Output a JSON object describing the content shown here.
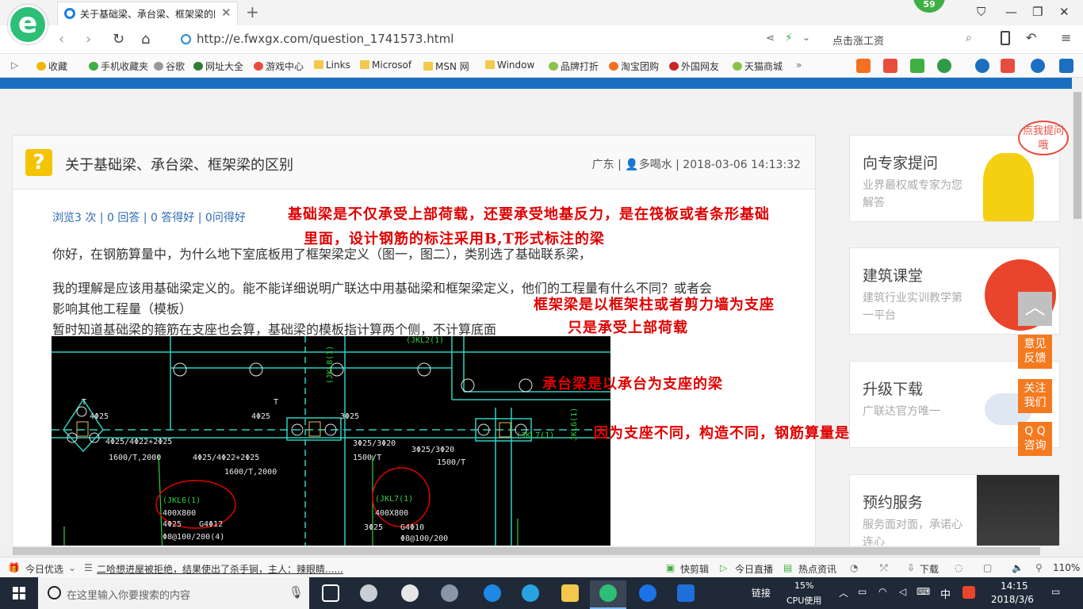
{
  "browser": {
    "logo_letter": "e",
    "tab_title": "关于基础梁、承台梁、框架梁的区",
    "tab_close": "✕",
    "new_tab": "+",
    "notification_count": "59",
    "url": "http://e.fwxgx.com/question_1741573.html",
    "search_hint": "点击涨工资"
  },
  "favorites": [
    {
      "label": "收藏",
      "icon": "star-icon"
    },
    {
      "label": "手机收藏夹",
      "icon": "phone-icon"
    },
    {
      "label": "谷歌",
      "icon": "page-icon"
    },
    {
      "label": "网址大全",
      "icon": "globe-icon"
    },
    {
      "label": "游戏中心",
      "icon": "game-icon"
    },
    {
      "label": "Links",
      "icon": "folder-icon"
    },
    {
      "label": "Microsof",
      "icon": "folder-icon"
    },
    {
      "label": "MSN 网",
      "icon": "folder-icon"
    },
    {
      "label": "Window",
      "icon": "folder-icon"
    },
    {
      "label": "品牌打折",
      "icon": "leaf-icon"
    },
    {
      "label": "淘宝团购",
      "icon": "tao-icon"
    },
    {
      "label": "外国网友",
      "icon": "flag-icon"
    },
    {
      "label": "天猫商城",
      "icon": "leaf-icon"
    }
  ],
  "question": {
    "icon_char": "?",
    "title": "关于基础梁、承台梁、框架梁的区别",
    "meta": "广东 | 👤多喝水 | 2018-03-06 14:13:32",
    "stats": "浏览3 次 | 0 回答 | 0 答得好 | 0问得好",
    "line1": "你好，在钢筋算量中，为什么地下室底板用了框架梁定义（图一，图二），类别选了基础联系梁，",
    "line2": "我的理解是应该用基础梁定义的。能不能详细说明广联达中用基础梁和框架梁定义，他们的工程量有什么不同？或者会",
    "line3": "影响其他工程量（模板）",
    "line4": "暂时知道基础梁的箍筋在支座也会算，基础梁的模板指计算两个侧，不计算底面"
  },
  "cad": {
    "labels": [
      "T",
      "4Φ25",
      "4Φ25/4Φ22+2Φ25",
      "1600/T,2000",
      "4Φ25/4Φ22+2Φ25",
      "1600/T,2000",
      "T",
      "4Φ25",
      "3Φ25",
      "3Φ25/3Φ20",
      "1500/T",
      "3Φ25/3Φ20",
      "1500/T",
      "4Φ25",
      "G4Φ12",
      "Φ8@100/200(4)",
      "3Φ25",
      "G4Φ10",
      "Φ8@100/200",
      "(JKL6(1)",
      "400X800",
      "(JKL7(1)",
      "400X800",
      "(JKL2(1)",
      "(JKL8(1)",
      "(JKL7(1)",
      "JKL6(1)"
    ]
  },
  "annotations": {
    "a1_line1": "基础梁是不仅承受上部荷载，还要承受地基反力，是在筏板或者条形基础",
    "a1_line2": "里面，设计钢筋的标注采用B,T形式标注的梁",
    "a2_line1": "框架梁是以框架柱或者剪力墙为支座",
    "a2_line2": "只是承受上部荷载",
    "a3": "承台梁是以承台为支座的梁",
    "a4": "因为支座不同，构造不同，钢筋算量是用区别的"
  },
  "sidebar": {
    "cards": [
      {
        "title": "向专家提问",
        "sub": "业界最权威专家为您解答",
        "badge": "点我提问哦"
      },
      {
        "title": "建筑课堂",
        "sub": "建筑行业实训教学第一平台"
      },
      {
        "title": "升级下载",
        "sub": "广联达官方唯一"
      },
      {
        "title": "预约服务",
        "sub": "服务面对面，承诺心连心"
      }
    ],
    "float_buttons": [
      "意见反馈",
      "关注我们",
      "Q Q咨询"
    ],
    "top_arrow": "︿"
  },
  "statusbar": {
    "today": "今日优选",
    "news": "二哈想进屋被拒绝，结果使出了杀手锏，主人：辣眼睛......",
    "items": [
      "快剪辑",
      "今日直播",
      "热点资讯",
      "下载"
    ],
    "zoom": "110%"
  },
  "taskbar": {
    "search_placeholder": "在这里输入你要搜索的内容",
    "link_label": "链接",
    "cpu_percent": "15%",
    "cpu_label": "CPU使用",
    "ime": "中",
    "time": "14:15",
    "date": "2018/3/6"
  },
  "colors": {
    "accent_blue": "#1b6fc1",
    "annotation_red": "#e00000",
    "float_orange": "#f47a20",
    "question_yellow": "#f5c400",
    "taskbar_bg": "#202938"
  }
}
